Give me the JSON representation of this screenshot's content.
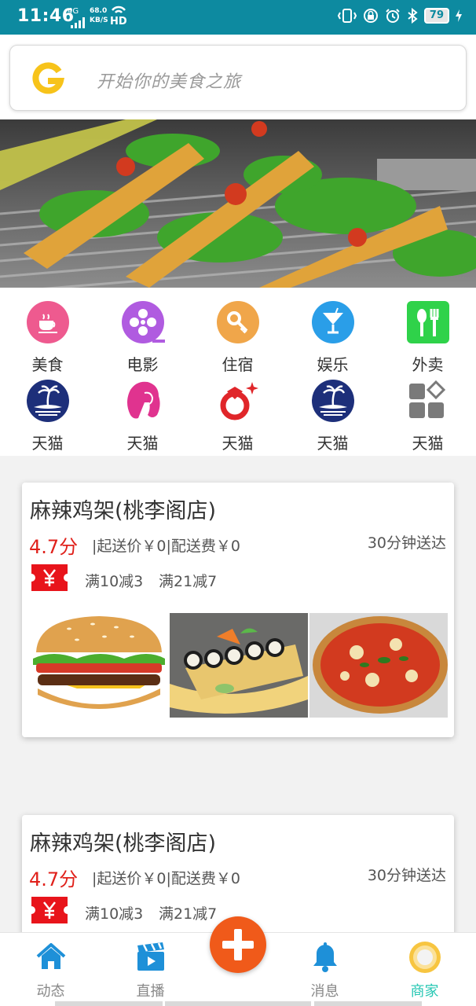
{
  "status_bar": {
    "time": "11:46",
    "network": "4G",
    "speed_value": "68.0",
    "speed_unit": "KB/S",
    "hd": "HD",
    "battery": "79"
  },
  "search": {
    "placeholder": "开始你的美食之旅",
    "logo_letter": "G"
  },
  "categories": [
    {
      "label": "美食",
      "icon": "coffee-icon",
      "color": "#ee5a8f"
    },
    {
      "label": "电影",
      "icon": "film-reel-icon",
      "color": "#b05be0"
    },
    {
      "label": "住宿",
      "icon": "key-icon",
      "color": "#f0a64a"
    },
    {
      "label": "娱乐",
      "icon": "cocktail-icon",
      "color": "#2a9ee8"
    },
    {
      "label": "外卖",
      "icon": "utensils-icon",
      "color": "#2fd24a"
    },
    {
      "label": "天猫",
      "icon": "palm-island-icon",
      "color": "#1d2f7a"
    },
    {
      "label": "天猫",
      "icon": "woman-face-icon",
      "color": "#e0338f"
    },
    {
      "label": "天猫",
      "icon": "ring-icon",
      "color": "#e0262a"
    },
    {
      "label": "天猫",
      "icon": "palm-island-icon",
      "color": "#1d2f7a"
    },
    {
      "label": "天猫",
      "icon": "grid-blocks-icon",
      "color": "#7a7a7a"
    }
  ],
  "shops": [
    {
      "name": "麻辣鸡架(桃李阁店)",
      "rating": "4.7分",
      "fee": "|起送价￥0|配送费￥0",
      "delivery_time": "30分钟送达",
      "coupon_icon": "yen-coupon-icon",
      "promos": [
        "满10减3",
        "满21减7"
      ],
      "photos": [
        "burger-photo",
        "sushi-photo",
        "pizza-photo"
      ]
    },
    {
      "name": "麻辣鸡架(桃李阁店)",
      "rating": "4.7分",
      "fee": "|起送价￥0|配送费￥0",
      "delivery_time": "30分钟送达",
      "coupon_icon": "yen-coupon-icon",
      "promos": [
        "满10减3",
        "满21减7"
      ]
    }
  ],
  "bottom_nav": {
    "items": [
      {
        "label": "动态",
        "icon": "home-icon"
      },
      {
        "label": "直播",
        "icon": "clapperboard-icon"
      },
      {
        "label": "",
        "icon": "plus-icon"
      },
      {
        "label": "消息",
        "icon": "bell-icon"
      },
      {
        "label": "商家",
        "icon": "merchant-circle-icon"
      }
    ],
    "active": "商家"
  },
  "colors": {
    "status_bar": "#0d8aa0",
    "accent_red": "#e0211b",
    "fab": "#f05a1a",
    "nav_active": "#25c7b3",
    "nav_icon_blue": "#1e90d8"
  }
}
